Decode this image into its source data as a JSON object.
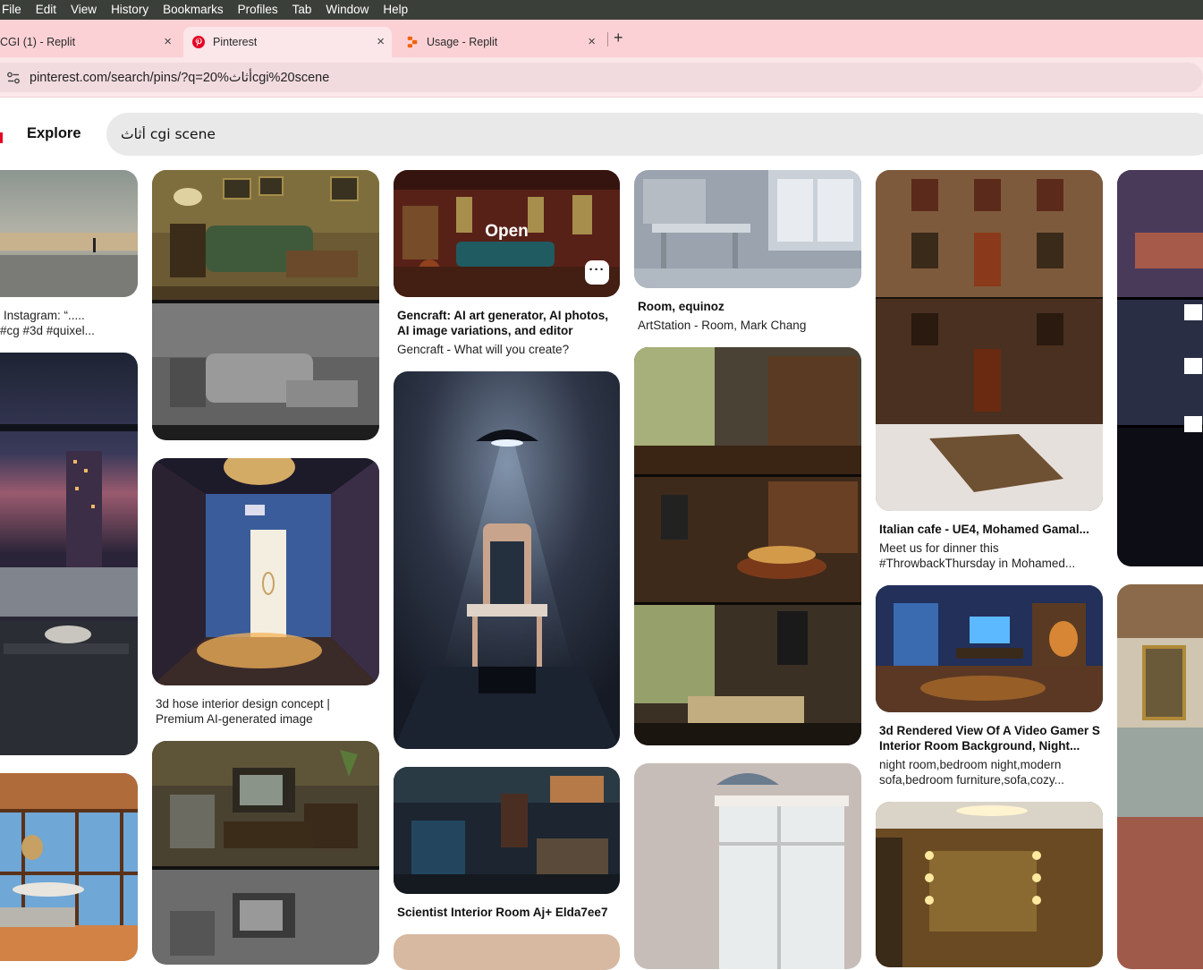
{
  "menubar": {
    "items": [
      "File",
      "Edit",
      "View",
      "History",
      "Bookmarks",
      "Profiles",
      "Tab",
      "Window",
      "Help"
    ]
  },
  "tabs": [
    {
      "title": "CGI (1) - Replit",
      "close": "×"
    },
    {
      "title": "Pinterest",
      "close": "×"
    },
    {
      "title": "Usage - Replit",
      "close": "×"
    }
  ],
  "new_tab": "+",
  "address_bar": {
    "url": "pinterest.com/search/pins/?q=20%أثاثcgi%20scene"
  },
  "pinterest": {
    "nav_label": "Explore",
    "search_value": "أثاث cgi scene",
    "accent_color": "#e60023"
  },
  "pins": {
    "col1_top": {
      "title_line1": "Instagram: “.....",
      "title_line2": "#cg #3d #quixel..."
    },
    "col3_top": {
      "hover_label": "Open",
      "more_label": "···",
      "title": "Gencraft: AI art generator, AI photos, AI image variations, and editor",
      "subtitle": "Gencraft - What will you create?"
    },
    "col4_top": {
      "title": "Room, equinoz",
      "subtitle": "ArtStation - Room, Mark Chang"
    },
    "col5_top": {
      "title": "Italian cafe - UE4, Mohamed Gamal...",
      "subtitle": "Meet us for dinner this #ThrowbackThursday in Mohamed..."
    },
    "col2_mid": {
      "title": "3d hose interior design concept | Premium AI-generated image"
    },
    "col5_mid": {
      "title": "3d Rendered View Of A Video Gamer S Interior Room Background, Night...",
      "subtitle": "night room,bedroom night,modern sofa,bedroom furniture,sofa,cozy..."
    },
    "col3_bottom": {
      "title": "Scientist Interior Room Aj+ Elda7ee7"
    }
  }
}
